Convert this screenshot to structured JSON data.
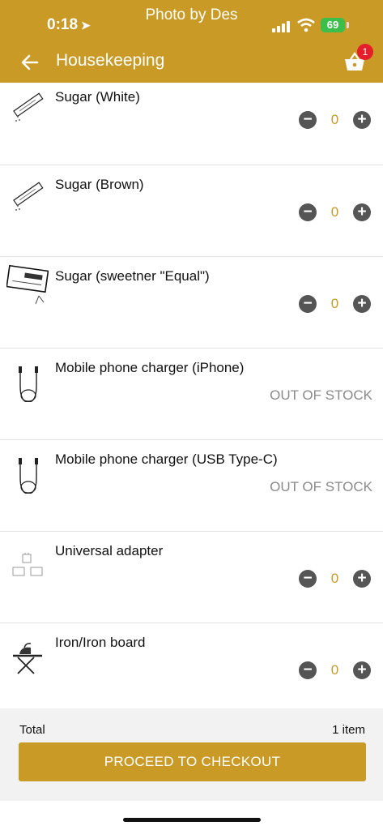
{
  "status": {
    "time": "0:18",
    "battery": "69",
    "overlay": "Photo by Des"
  },
  "header": {
    "title": "Housekeeping",
    "cart_count": "1"
  },
  "items": [
    {
      "name": "Sugar (White)",
      "qty": "0",
      "minus": "−",
      "plus": "+",
      "out_of_stock": "",
      "icon": "sugar-stick-icon"
    },
    {
      "name": "Sugar (Brown)",
      "qty": "0",
      "minus": "−",
      "plus": "+",
      "out_of_stock": "",
      "icon": "sugar-stick-icon"
    },
    {
      "name": "Sugar (sweetner \"Equal\")",
      "qty": "0",
      "minus": "−",
      "plus": "+",
      "out_of_stock": "",
      "icon": "sweetener-packet-icon"
    },
    {
      "name": "Mobile phone charger (iPhone)",
      "qty": "",
      "minus": "",
      "plus": "",
      "out_of_stock": "OUT OF STOCK",
      "icon": "charger-cable-icon"
    },
    {
      "name": "Mobile phone charger (USB Type-C)",
      "qty": "",
      "minus": "",
      "plus": "",
      "out_of_stock": "OUT OF STOCK",
      "icon": "charger-cable-icon"
    },
    {
      "name": "Universal adapter",
      "qty": "0",
      "minus": "−",
      "plus": "+",
      "out_of_stock": "",
      "icon": "adapter-icon"
    },
    {
      "name": "Iron/Iron board",
      "qty": "0",
      "minus": "−",
      "plus": "+",
      "out_of_stock": "",
      "icon": "iron-board-icon"
    }
  ],
  "footer": {
    "total_label": "Total",
    "item_count": "1 item",
    "checkout_label": "PROCEED TO CHECKOUT"
  },
  "colors": {
    "accent": "#c99a25",
    "badge": "#e41e2b"
  }
}
